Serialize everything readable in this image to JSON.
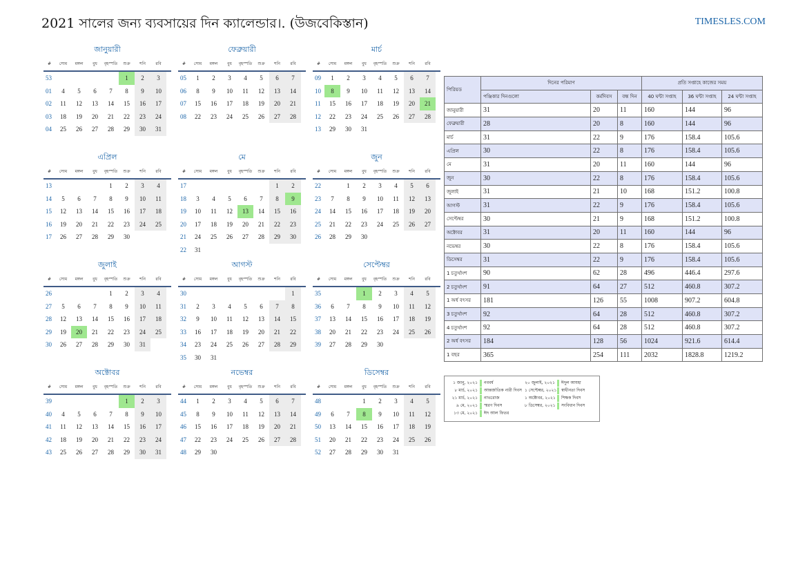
{
  "header": {
    "title": "2021 সালের জন্য ব্যবসায়ের দিন ক্যালেন্ডার।. (উজবেকিস্তান)",
    "site": "TIMESLES.COM"
  },
  "weekday_header": [
    "#",
    "সোম",
    "মঙ্গল",
    "বুধ",
    "বৃহস্পতি",
    "শুক্র",
    "শনি",
    "রবি"
  ],
  "months": [
    {
      "name": "জানুয়ারী",
      "weeks": [
        {
          "wk": "53",
          "days": [
            "",
            "",
            "",
            "",
            "1",
            "2",
            "3"
          ]
        },
        {
          "wk": "01",
          "days": [
            "4",
            "5",
            "6",
            "7",
            "8",
            "9",
            "10"
          ]
        },
        {
          "wk": "02",
          "days": [
            "11",
            "12",
            "13",
            "14",
            "15",
            "16",
            "17"
          ]
        },
        {
          "wk": "03",
          "days": [
            "18",
            "19",
            "20",
            "21",
            "22",
            "23",
            "24"
          ]
        },
        {
          "wk": "04",
          "days": [
            "25",
            "26",
            "27",
            "28",
            "29",
            "30",
            "31"
          ]
        }
      ],
      "holidays": [
        "1"
      ]
    },
    {
      "name": "ফেব্রুয়ারী",
      "weeks": [
        {
          "wk": "05",
          "days": [
            "1",
            "2",
            "3",
            "4",
            "5",
            "6",
            "7"
          ]
        },
        {
          "wk": "06",
          "days": [
            "8",
            "9",
            "10",
            "11",
            "12",
            "13",
            "14"
          ]
        },
        {
          "wk": "07",
          "days": [
            "15",
            "16",
            "17",
            "18",
            "19",
            "20",
            "21"
          ]
        },
        {
          "wk": "08",
          "days": [
            "22",
            "23",
            "24",
            "25",
            "26",
            "27",
            "28"
          ]
        }
      ],
      "holidays": []
    },
    {
      "name": "মার্চ",
      "weeks": [
        {
          "wk": "09",
          "days": [
            "1",
            "2",
            "3",
            "4",
            "5",
            "6",
            "7"
          ]
        },
        {
          "wk": "10",
          "days": [
            "8",
            "9",
            "10",
            "11",
            "12",
            "13",
            "14"
          ]
        },
        {
          "wk": "11",
          "days": [
            "15",
            "16",
            "17",
            "18",
            "19",
            "20",
            "21"
          ]
        },
        {
          "wk": "12",
          "days": [
            "22",
            "23",
            "24",
            "25",
            "26",
            "27",
            "28"
          ]
        },
        {
          "wk": "13",
          "days": [
            "29",
            "30",
            "31",
            "",
            "",
            "",
            ""
          ]
        }
      ],
      "holidays": [
        "8",
        "21"
      ]
    },
    {
      "name": "এপ্রিল",
      "weeks": [
        {
          "wk": "13",
          "days": [
            "",
            "",
            "",
            "1",
            "2",
            "3",
            "4"
          ]
        },
        {
          "wk": "14",
          "days": [
            "5",
            "6",
            "7",
            "8",
            "9",
            "10",
            "11"
          ]
        },
        {
          "wk": "15",
          "days": [
            "12",
            "13",
            "14",
            "15",
            "16",
            "17",
            "18"
          ]
        },
        {
          "wk": "16",
          "days": [
            "19",
            "20",
            "21",
            "22",
            "23",
            "24",
            "25"
          ]
        },
        {
          "wk": "17",
          "days": [
            "26",
            "27",
            "28",
            "29",
            "30",
            "",
            ""
          ]
        }
      ],
      "holidays": []
    },
    {
      "name": "মে",
      "weeks": [
        {
          "wk": "17",
          "days": [
            "",
            "",
            "",
            "",
            "",
            "1",
            "2"
          ]
        },
        {
          "wk": "18",
          "days": [
            "3",
            "4",
            "5",
            "6",
            "7",
            "8",
            "9"
          ]
        },
        {
          "wk": "19",
          "days": [
            "10",
            "11",
            "12",
            "13",
            "14",
            "15",
            "16"
          ]
        },
        {
          "wk": "20",
          "days": [
            "17",
            "18",
            "19",
            "20",
            "21",
            "22",
            "23"
          ]
        },
        {
          "wk": "21",
          "days": [
            "24",
            "25",
            "26",
            "27",
            "28",
            "29",
            "30"
          ]
        },
        {
          "wk": "22",
          "days": [
            "31",
            "",
            "",
            "",
            "",
            "",
            ""
          ]
        }
      ],
      "holidays": [
        "9",
        "13"
      ]
    },
    {
      "name": "জুন",
      "weeks": [
        {
          "wk": "22",
          "days": [
            "",
            "1",
            "2",
            "3",
            "4",
            "5",
            "6"
          ]
        },
        {
          "wk": "23",
          "days": [
            "7",
            "8",
            "9",
            "10",
            "11",
            "12",
            "13"
          ]
        },
        {
          "wk": "24",
          "days": [
            "14",
            "15",
            "16",
            "17",
            "18",
            "19",
            "20"
          ]
        },
        {
          "wk": "25",
          "days": [
            "21",
            "22",
            "23",
            "24",
            "25",
            "26",
            "27"
          ]
        },
        {
          "wk": "26",
          "days": [
            "28",
            "29",
            "30",
            "",
            "",
            "",
            ""
          ]
        }
      ],
      "holidays": []
    },
    {
      "name": "জুলাই",
      "weeks": [
        {
          "wk": "26",
          "days": [
            "",
            "",
            "",
            "1",
            "2",
            "3",
            "4"
          ]
        },
        {
          "wk": "27",
          "days": [
            "5",
            "6",
            "7",
            "8",
            "9",
            "10",
            "11"
          ]
        },
        {
          "wk": "28",
          "days": [
            "12",
            "13",
            "14",
            "15",
            "16",
            "17",
            "18"
          ]
        },
        {
          "wk": "29",
          "days": [
            "19",
            "20",
            "21",
            "22",
            "23",
            "24",
            "25"
          ]
        },
        {
          "wk": "30",
          "days": [
            "26",
            "27",
            "28",
            "29",
            "30",
            "31",
            ""
          ]
        }
      ],
      "holidays": [
        "20"
      ]
    },
    {
      "name": "আগস্ট",
      "weeks": [
        {
          "wk": "30",
          "days": [
            "",
            "",
            "",
            "",
            "",
            "",
            "1"
          ]
        },
        {
          "wk": "31",
          "days": [
            "2",
            "3",
            "4",
            "5",
            "6",
            "7",
            "8"
          ]
        },
        {
          "wk": "32",
          "days": [
            "9",
            "10",
            "11",
            "12",
            "13",
            "14",
            "15"
          ]
        },
        {
          "wk": "33",
          "days": [
            "16",
            "17",
            "18",
            "19",
            "20",
            "21",
            "22"
          ]
        },
        {
          "wk": "34",
          "days": [
            "23",
            "24",
            "25",
            "26",
            "27",
            "28",
            "29"
          ]
        },
        {
          "wk": "35",
          "days": [
            "30",
            "31",
            "",
            "",
            "",
            "",
            ""
          ]
        }
      ],
      "holidays": []
    },
    {
      "name": "সেপ্টেম্বর",
      "weeks": [
        {
          "wk": "35",
          "days": [
            "",
            "",
            "1",
            "2",
            "3",
            "4",
            "5"
          ]
        },
        {
          "wk": "36",
          "days": [
            "6",
            "7",
            "8",
            "9",
            "10",
            "11",
            "12"
          ]
        },
        {
          "wk": "37",
          "days": [
            "13",
            "14",
            "15",
            "16",
            "17",
            "18",
            "19"
          ]
        },
        {
          "wk": "38",
          "days": [
            "20",
            "21",
            "22",
            "23",
            "24",
            "25",
            "26"
          ]
        },
        {
          "wk": "39",
          "days": [
            "27",
            "28",
            "29",
            "30",
            "",
            "",
            ""
          ]
        }
      ],
      "holidays": [
        "1"
      ]
    },
    {
      "name": "অক্টোবর",
      "weeks": [
        {
          "wk": "39",
          "days": [
            "",
            "",
            "",
            "",
            "1",
            "2",
            "3"
          ]
        },
        {
          "wk": "40",
          "days": [
            "4",
            "5",
            "6",
            "7",
            "8",
            "9",
            "10"
          ]
        },
        {
          "wk": "41",
          "days": [
            "11",
            "12",
            "13",
            "14",
            "15",
            "16",
            "17"
          ]
        },
        {
          "wk": "42",
          "days": [
            "18",
            "19",
            "20",
            "21",
            "22",
            "23",
            "24"
          ]
        },
        {
          "wk": "43",
          "days": [
            "25",
            "26",
            "27",
            "28",
            "29",
            "30",
            "31"
          ]
        }
      ],
      "holidays": [
        "1"
      ]
    },
    {
      "name": "নভেম্বর",
      "weeks": [
        {
          "wk": "44",
          "days": [
            "1",
            "2",
            "3",
            "4",
            "5",
            "6",
            "7"
          ]
        },
        {
          "wk": "45",
          "days": [
            "8",
            "9",
            "10",
            "11",
            "12",
            "13",
            "14"
          ]
        },
        {
          "wk": "46",
          "days": [
            "15",
            "16",
            "17",
            "18",
            "19",
            "20",
            "21"
          ]
        },
        {
          "wk": "47",
          "days": [
            "22",
            "23",
            "24",
            "25",
            "26",
            "27",
            "28"
          ]
        },
        {
          "wk": "48",
          "days": [
            "29",
            "30",
            "",
            "",
            "",
            "",
            ""
          ]
        }
      ],
      "holidays": []
    },
    {
      "name": "ডিসেম্বর",
      "weeks": [
        {
          "wk": "48",
          "days": [
            "",
            "",
            "1",
            "2",
            "3",
            "4",
            "5"
          ]
        },
        {
          "wk": "49",
          "days": [
            "6",
            "7",
            "8",
            "9",
            "10",
            "11",
            "12"
          ]
        },
        {
          "wk": "50",
          "days": [
            "13",
            "14",
            "15",
            "16",
            "17",
            "18",
            "19"
          ]
        },
        {
          "wk": "51",
          "days": [
            "20",
            "21",
            "22",
            "23",
            "24",
            "25",
            "26"
          ]
        },
        {
          "wk": "52",
          "days": [
            "27",
            "28",
            "29",
            "30",
            "31",
            "",
            ""
          ]
        }
      ],
      "holidays": [
        "8"
      ]
    }
  ],
  "stats": {
    "header": {
      "period": "পিরিয়ড",
      "days_count": "দিনের পরিমাণ",
      "hours_per_week": "প্রতি সপ্তাহে কাজের সময়",
      "calendar_days": "পঞ্জিকার দিনগুলো",
      "work_days": "কর্মদিবস",
      "off_days": "বন্ধ দিন",
      "h40": "40 ঘন্টা সপ্তাহ",
      "h36": "36 ঘন্টা সপ্তাহ",
      "h24": "24 ঘন্টা সপ্তাহ"
    },
    "rows": [
      [
        "জানুয়ারী",
        "31",
        "20",
        "11",
        "160",
        "144",
        "96"
      ],
      [
        "ফেব্রুয়ারী",
        "28",
        "20",
        "8",
        "160",
        "144",
        "96"
      ],
      [
        "মার্চ",
        "31",
        "22",
        "9",
        "176",
        "158.4",
        "105.6"
      ],
      [
        "এপ্রিল",
        "30",
        "22",
        "8",
        "176",
        "158.4",
        "105.6"
      ],
      [
        "মে",
        "31",
        "20",
        "11",
        "160",
        "144",
        "96"
      ],
      [
        "জুন",
        "30",
        "22",
        "8",
        "176",
        "158.4",
        "105.6"
      ],
      [
        "জুলাই",
        "31",
        "21",
        "10",
        "168",
        "151.2",
        "100.8"
      ],
      [
        "আগস্ট",
        "31",
        "22",
        "9",
        "176",
        "158.4",
        "105.6"
      ],
      [
        "সেপ্টেম্বর",
        "30",
        "21",
        "9",
        "168",
        "151.2",
        "100.8"
      ],
      [
        "অক্টোবর",
        "31",
        "20",
        "11",
        "160",
        "144",
        "96"
      ],
      [
        "নভেম্বর",
        "30",
        "22",
        "8",
        "176",
        "158.4",
        "105.6"
      ],
      [
        "ডিসেম্বর",
        "31",
        "22",
        "9",
        "176",
        "158.4",
        "105.6"
      ],
      [
        "1 চতুর্থাংশ",
        "90",
        "62",
        "28",
        "496",
        "446.4",
        "297.6"
      ],
      [
        "2 চতুর্থাংশ",
        "91",
        "64",
        "27",
        "512",
        "460.8",
        "307.2"
      ],
      [
        "1 অর্ধ বৎসর",
        "181",
        "126",
        "55",
        "1008",
        "907.2",
        "604.8"
      ],
      [
        "3 চতুর্থাংশ",
        "92",
        "64",
        "28",
        "512",
        "460.8",
        "307.2"
      ],
      [
        "4 চতুর্থাংশ",
        "92",
        "64",
        "28",
        "512",
        "460.8",
        "307.2"
      ],
      [
        "2 অর্ধ বৎসর",
        "184",
        "128",
        "56",
        "1024",
        "921.6",
        "614.4"
      ],
      [
        "1 বছর",
        "365",
        "254",
        "111",
        "2032",
        "1828.8",
        "1219.2"
      ]
    ]
  },
  "holidays_legend": [
    {
      "date": "১ জানু, ২০২১",
      "name": "নববর্ষ"
    },
    {
      "date": "২০ জুলাই, ২০২১",
      "name": "ঈদুল আযহা"
    },
    {
      "date": "৮ মার্চ, ২০২১",
      "name": "আন্তর্জাতিক নারী দিবস"
    },
    {
      "date": "১ সেপ্টেম্বর, ২০২১",
      "name": "স্বাধীনতা দিবস"
    },
    {
      "date": "২১ মার্চ, ২০২১",
      "name": "নাভরোজ"
    },
    {
      "date": "১ অক্টোবর, ২০২১",
      "name": "শিক্ষক দিবস"
    },
    {
      "date": "৯ মে, ২০২১",
      "name": "স্মরণ দিবস"
    },
    {
      "date": "৮ ডিসেম্বর, ২০২১",
      "name": "সংবিধান দিবস"
    },
    {
      "date": "১৩ মে, ২০২১",
      "name": "ঈদ আল ফিতর"
    }
  ],
  "colors": {
    "accent": "#1a64a8",
    "holiday": "#9fe78f",
    "weekend": "#ececec",
    "table_header": "#dfe3f7",
    "rule": "#3e5a86"
  }
}
